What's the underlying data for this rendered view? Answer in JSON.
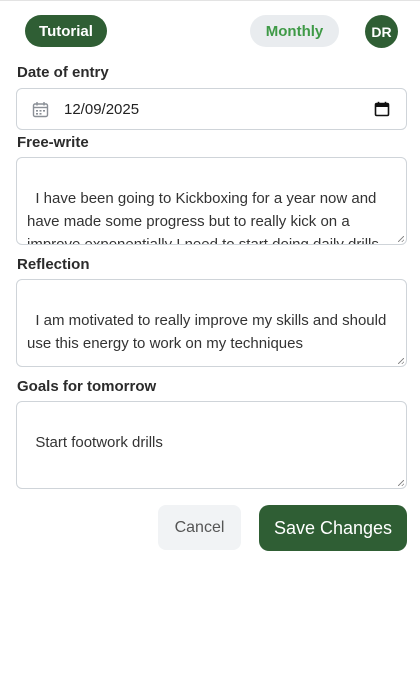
{
  "header": {
    "tutorial_label": "Tutorial",
    "monthly_label": "Monthly",
    "avatar_initials": "DR"
  },
  "form": {
    "date": {
      "label": "Date of entry",
      "value": "12/09/2025"
    },
    "freewrite": {
      "label": "Free-write",
      "value": "I have been going to Kickboxing for a year now and have made some progress but to really kick on a improve exponentially I need to start doing daily drills specifically focused on detailed techniques and"
    },
    "reflection": {
      "label": "Reflection",
      "value": "I am motivated to really improve my skills and should use this energy to work on my techniques"
    },
    "goals": {
      "label": "Goals for tomorrow",
      "value": "Start footwork drills"
    }
  },
  "actions": {
    "cancel_label": "Cancel",
    "save_label": "Save Changes"
  },
  "colors": {
    "primary": "#2f5e34",
    "monthly_text": "#3f9a47",
    "pill_bg": "#e9ecef"
  }
}
